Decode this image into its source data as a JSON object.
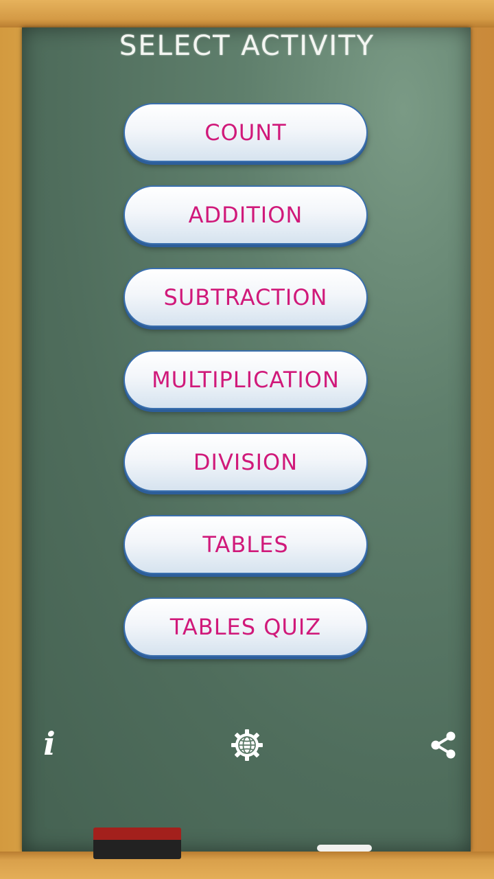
{
  "screen": {
    "title": "SELECT ACTIVITY"
  },
  "menu": {
    "items": [
      {
        "label": "COUNT"
      },
      {
        "label": "ADDITION"
      },
      {
        "label": "SUBTRACTION"
      },
      {
        "label": "MULTIPLICATION"
      },
      {
        "label": "DIVISION"
      },
      {
        "label": "TABLES"
      },
      {
        "label": "TABLES QUIZ"
      }
    ]
  },
  "footer": {
    "info_icon": "info-icon",
    "language_icon": "globe-gear-icon",
    "share_icon": "share-icon",
    "info_glyph": "i"
  },
  "colors": {
    "board": "#4f6d5c",
    "frame": "#d9a04b",
    "button_text": "#d0197a",
    "button_border": "#3a6fae",
    "title_text": "#f4f6f2"
  }
}
